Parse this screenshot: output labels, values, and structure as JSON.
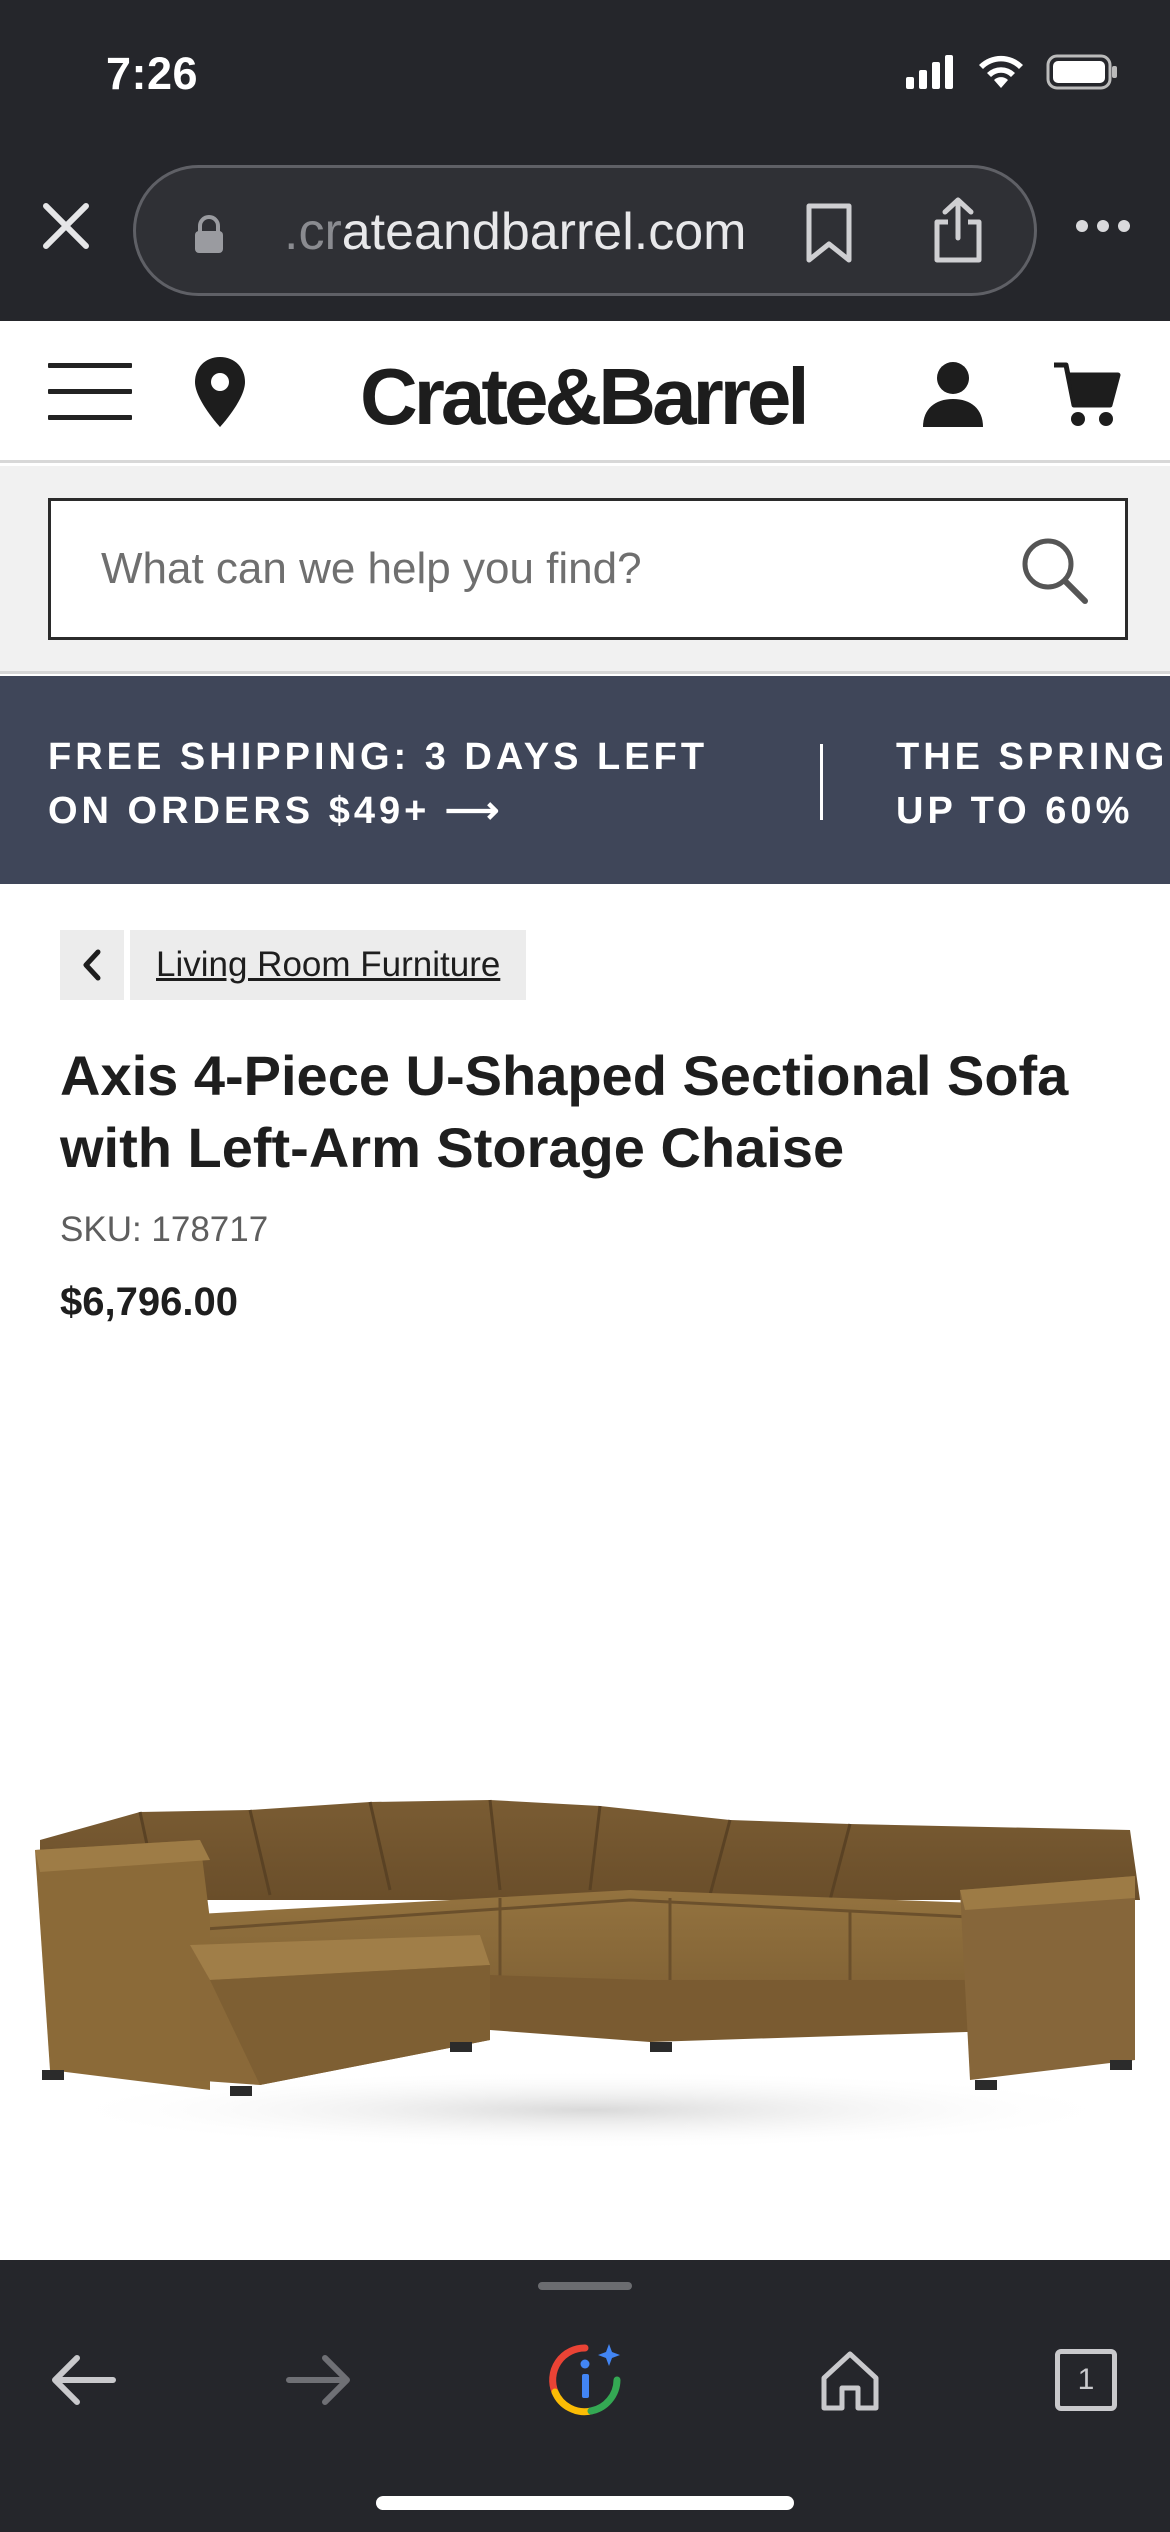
{
  "status_bar": {
    "time": "7:26"
  },
  "browser": {
    "url_faded": ".cr",
    "url_main": "ateandbarrel.com",
    "close_label": "close",
    "tab_count": "1"
  },
  "header": {
    "brand": "Crate&Barrel"
  },
  "search": {
    "placeholder": "What can we help you find?"
  },
  "promo": {
    "left_line1": "FREE SHIPPING: 3 DAYS LEFT",
    "left_line2": "ON ORDERS $49+",
    "arrow": "⟶",
    "right_line1": "THE SPRING",
    "right_line2": "UP TO 60%"
  },
  "breadcrumb": {
    "label": "Living Room Furniture"
  },
  "product": {
    "title": "Axis 4-Piece U-Shaped Sectional Sofa with Left-Arm Storage Chaise",
    "sku": "SKU: 178717",
    "price": "$6,796.00"
  },
  "colors": {
    "chrome": "#25262b",
    "promo_bg": "#3f4659",
    "sofa": "#8a6a3c"
  }
}
